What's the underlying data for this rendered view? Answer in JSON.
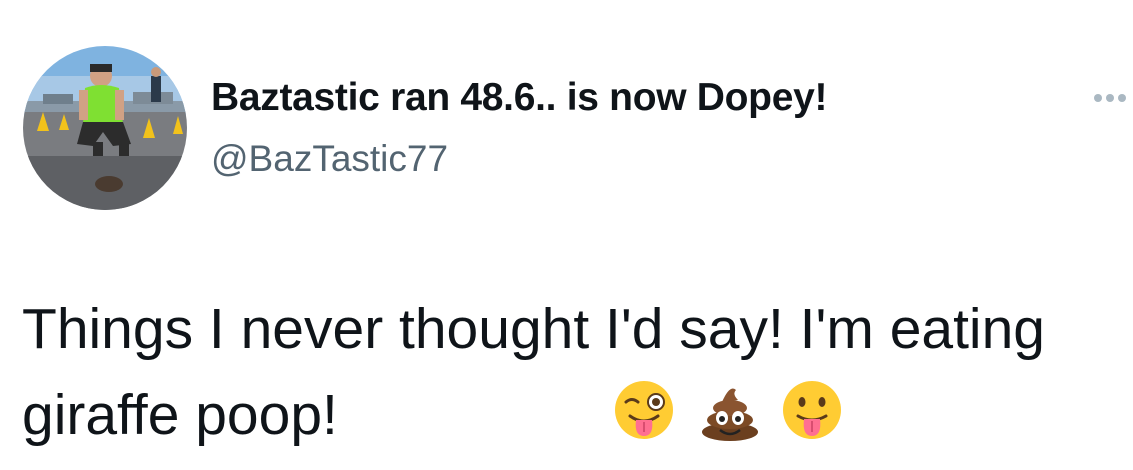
{
  "author": {
    "display_name": "Baztastic ran 48.6.. is now Dopey!",
    "handle": "@BazTastic77",
    "avatar_icon": "runner-photo-avatar"
  },
  "more_icon": "ellipsis-icon",
  "tweet": {
    "text": "Things I never thought I'd say! I'm eating giraffe poop!",
    "emojis": [
      "winking-face-with-tongue",
      "pile-of-poo",
      "face-with-tongue"
    ]
  },
  "colors": {
    "text_primary": "#0f1419",
    "text_secondary": "#536471",
    "more_icon": "#aab8c2"
  }
}
